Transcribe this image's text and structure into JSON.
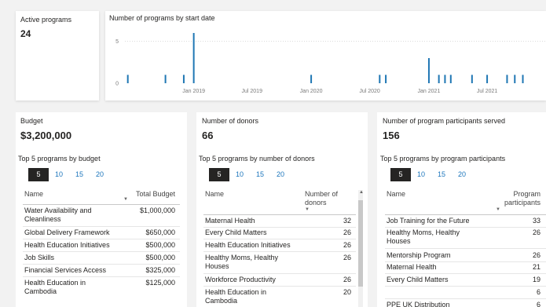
{
  "active_programs": {
    "label": "Active programs",
    "value": "24"
  },
  "chart_data": {
    "type": "bar",
    "title": "Number of programs by start date",
    "xlabel": "",
    "ylabel": "",
    "ylim": [
      0,
      6
    ],
    "y_ticks": [
      "0",
      "5"
    ],
    "x_tick_labels": [
      "Jan 2019",
      "Jul 2019",
      "Jan 2020",
      "Jul 2020",
      "Jan 2021",
      "Jul 2021"
    ],
    "x_domain": [
      "2018-06-01",
      "2021-12-31"
    ],
    "bar_color": "#1f77b4",
    "points": [
      {
        "date": "2018-06-10",
        "value": 1
      },
      {
        "date": "2018-10-05",
        "value": 1
      },
      {
        "date": "2018-12-01",
        "value": 1
      },
      {
        "date": "2019-01-01",
        "value": 6
      },
      {
        "date": "2020-01-01",
        "value": 1
      },
      {
        "date": "2020-08-01",
        "value": 1
      },
      {
        "date": "2020-08-20",
        "value": 1
      },
      {
        "date": "2021-01-01",
        "value": 3
      },
      {
        "date": "2021-02-01",
        "value": 1
      },
      {
        "date": "2021-02-20",
        "value": 1
      },
      {
        "date": "2021-03-10",
        "value": 1
      },
      {
        "date": "2021-05-15",
        "value": 1
      },
      {
        "date": "2021-07-01",
        "value": 1
      },
      {
        "date": "2021-09-01",
        "value": 1
      },
      {
        "date": "2021-09-25",
        "value": 1
      },
      {
        "date": "2021-10-20",
        "value": 1
      }
    ]
  },
  "budget": {
    "label": "Budget",
    "value": "$3,200,000",
    "top_title": "Top 5 programs by budget",
    "tabs": [
      "5",
      "10",
      "15",
      "20"
    ],
    "col_name": "Name",
    "col_value": "Total Budget",
    "rows": [
      {
        "name": "Water Availability and",
        "name2": "Cleanliness",
        "value": "$1,000,000"
      },
      {
        "name": "Global Delivery Framework",
        "value": "$650,000"
      },
      {
        "name": "Health Education Initiatives",
        "value": "$500,000"
      },
      {
        "name": "Job Skills",
        "value": "$500,000"
      },
      {
        "name": "Financial Services Access",
        "value": "$325,000"
      },
      {
        "name": "Health Education in",
        "name2": "Cambodia",
        "value": "$125,000"
      }
    ]
  },
  "donors": {
    "label": "Number of donors",
    "value": "66",
    "top_title": "Top 5 programs by number of donors",
    "tabs": [
      "5",
      "10",
      "15",
      "20"
    ],
    "col_name": "Name",
    "col_value": "Number of",
    "col_value2": "donors",
    "rows": [
      {
        "name": "Maternal Health",
        "value": "32"
      },
      {
        "name": "Every Child Matters",
        "value": "26"
      },
      {
        "name": "Health Education Initiatives",
        "value": "26"
      },
      {
        "name": "Healthy Moms, Healthy",
        "name2": "Houses",
        "value": "26"
      },
      {
        "name": "Workforce Productivity",
        "value": "26"
      },
      {
        "name": "Health Education in",
        "name2": "Cambodia",
        "value": "20"
      }
    ]
  },
  "participants": {
    "label": "Number of program participants served",
    "value": "156",
    "top_title": "Top 5 programs by program participants",
    "tabs": [
      "5",
      "10",
      "15",
      "20"
    ],
    "col_name": "Name",
    "col_value": "Program",
    "col_value2": "participants",
    "rows": [
      {
        "name": "Job Training for the Future",
        "value": "33"
      },
      {
        "name": "Healthy Moms, Healthy",
        "name2": "Houses",
        "value": "26"
      },
      {
        "name": "Mentorship Program",
        "value": "26"
      },
      {
        "name": "Maternal Health",
        "value": "21"
      },
      {
        "name": "Every Child Matters",
        "value": "19"
      },
      {
        "name": "",
        "value": "6"
      },
      {
        "name": "PPE UK Distribution",
        "value": "6"
      }
    ]
  }
}
